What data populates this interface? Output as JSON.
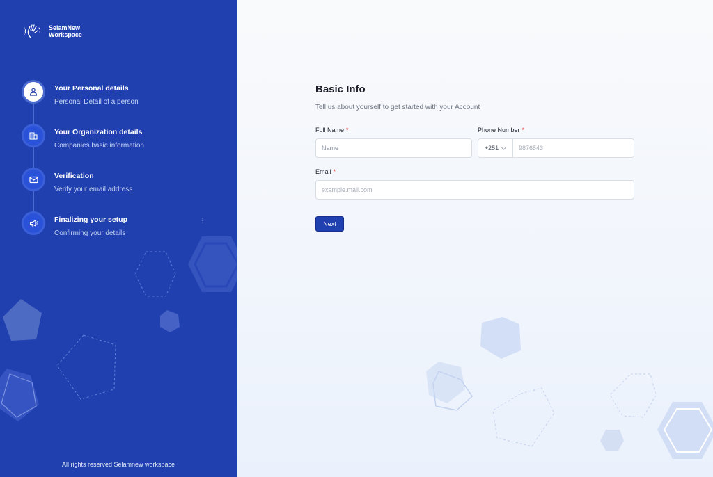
{
  "brand": {
    "line1": "SelamNew",
    "line2": "Workspace",
    "icon": "waving-hand-icon"
  },
  "steps": [
    {
      "title": "Your Personal details",
      "subtitle": "Personal Detail of a person",
      "icon": "user-icon",
      "active": true
    },
    {
      "title": "Your Organization details",
      "subtitle": "Companies basic information",
      "icon": "building-icon",
      "active": false
    },
    {
      "title": "Verification",
      "subtitle": "Verify your email address",
      "icon": "mail-icon",
      "active": false
    },
    {
      "title": "Finalizing your setup",
      "subtitle": "Confirming your details",
      "icon": "megaphone-icon",
      "active": false
    }
  ],
  "footer": "All rights reserved Selamnew workspace",
  "form": {
    "title": "Basic Info",
    "subtitle": "Tell us about yourself  to get started with your Account",
    "full_name": {
      "label": "Full Name",
      "required": "*",
      "placeholder": "Name"
    },
    "phone": {
      "label": "Phone Number",
      "required": "*",
      "country_code": "+251",
      "placeholder": "9876543"
    },
    "email": {
      "label": "Email",
      "required": "*",
      "placeholder": "example.mail.com"
    },
    "next_label": "Next"
  },
  "colors": {
    "sidebar": "#2040b0",
    "accent": "#2040b0",
    "required": "#e03a3a"
  }
}
